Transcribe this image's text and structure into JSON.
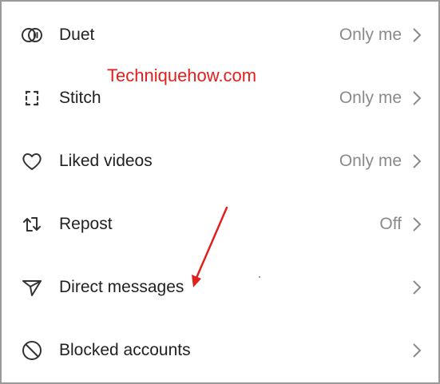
{
  "settings": {
    "rows": [
      {
        "label": "Duet",
        "value": "Only me",
        "icon": "duet-icon"
      },
      {
        "label": "Stitch",
        "value": "Only me",
        "icon": "stitch-icon"
      },
      {
        "label": "Liked videos",
        "value": "Only me",
        "icon": "heart-icon"
      },
      {
        "label": "Repost",
        "value": "Off",
        "icon": "repost-icon"
      },
      {
        "label": "Direct messages",
        "value": "",
        "icon": "send-icon"
      },
      {
        "label": "Blocked accounts",
        "value": "",
        "icon": "block-icon"
      }
    ]
  },
  "watermark": {
    "text": "Techniquehow.com",
    "color": "#e0201c"
  },
  "colors": {
    "label": "#222222",
    "value": "#8a8a8a",
    "icon": "#333333",
    "chevron": "#8a8a8a",
    "annotation": "#e0201c"
  }
}
